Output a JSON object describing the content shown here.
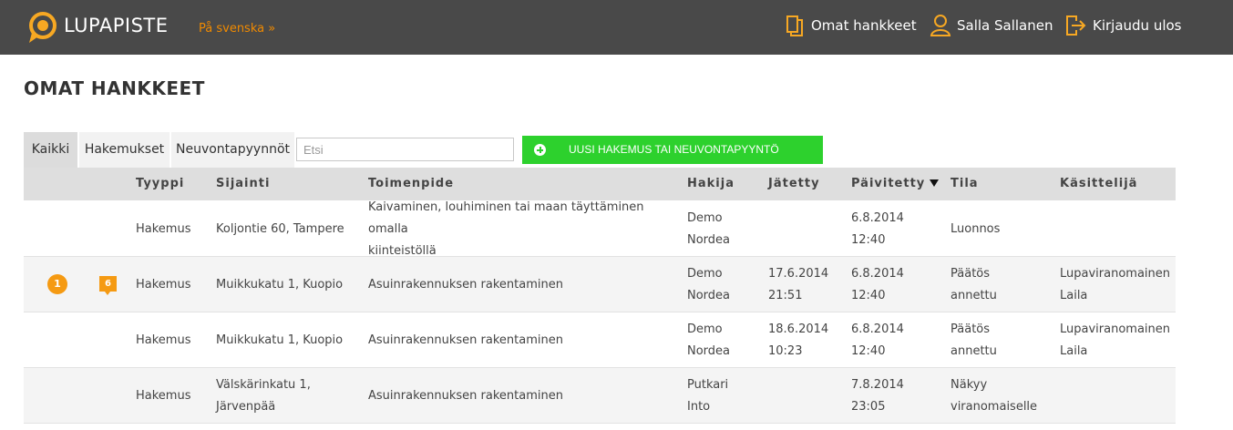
{
  "header": {
    "brand": "LUPAPISTE",
    "language_link": "På svenska »",
    "nav": {
      "projects": "Omat hankkeet",
      "user": "Salla Sallanen",
      "logout": "Kirjaudu ulos"
    },
    "accent_color": "#f08a00",
    "background_color": "#494949"
  },
  "page_title": "OMAT HANKKEET",
  "tabs": [
    {
      "label": "Kaikki",
      "active": true
    },
    {
      "label": "Hakemukset",
      "active": false
    },
    {
      "label": "Neuvontapyynnöt",
      "active": false
    }
  ],
  "search": {
    "placeholder": "Etsi",
    "value": ""
  },
  "new_button": {
    "label": "UUSI HAKEMUS TAI NEUVONTAPYYNTÖ",
    "color": "#2dd12d"
  },
  "table": {
    "columns": {
      "type": "Tyyppi",
      "location": "Sijainti",
      "operation": "Toimenpide",
      "applicant": "Hakija",
      "submitted": "Jätetty",
      "updated": "Päivitetty",
      "state": "Tila",
      "handler": "Käsittelijä"
    },
    "sorted_by": "updated",
    "sort_direction": "descending",
    "rows": [
      {
        "indicator": "",
        "comments": "",
        "type": "Hakemus",
        "location": [
          "Koljontie 60, Tampere"
        ],
        "operation": [
          "Kaivaminen, louhiminen tai maan täyttäminen omalla",
          "kiinteistöllä"
        ],
        "applicant": [
          "Demo",
          "Nordea"
        ],
        "submitted": [],
        "updated": [
          "6.8.2014",
          "12:40"
        ],
        "state": [
          "Luonnos"
        ],
        "handler": []
      },
      {
        "indicator": "1",
        "comments": "6",
        "type": "Hakemus",
        "location": [
          "Muikkukatu 1, Kuopio"
        ],
        "operation": [
          "Asuinrakennuksen rakentaminen"
        ],
        "applicant": [
          "Demo",
          "Nordea"
        ],
        "submitted": [
          "17.6.2014",
          "21:51"
        ],
        "updated": [
          "6.8.2014",
          "12:40"
        ],
        "state": [
          "Päätös",
          "annettu"
        ],
        "handler": [
          "Lupaviranomainen",
          "Laila"
        ]
      },
      {
        "indicator": "",
        "comments": "",
        "type": "Hakemus",
        "location": [
          "Muikkukatu 1, Kuopio"
        ],
        "operation": [
          "Asuinrakennuksen rakentaminen"
        ],
        "applicant": [
          "Demo",
          "Nordea"
        ],
        "submitted": [
          "18.6.2014",
          "10:23"
        ],
        "updated": [
          "6.8.2014",
          "12:40"
        ],
        "state": [
          "Päätös",
          "annettu"
        ],
        "handler": [
          "Lupaviranomainen",
          "Laila"
        ]
      },
      {
        "indicator": "",
        "comments": "",
        "type": "Hakemus",
        "location": [
          "Välskärinkatu 1,",
          "Järvenpää"
        ],
        "operation": [
          "Asuinrakennuksen rakentaminen"
        ],
        "applicant": [
          "Putkari",
          "Into"
        ],
        "submitted": [],
        "updated": [
          "7.8.2014",
          "23:05"
        ],
        "state": [
          "Näkyy",
          "viranomaiselle"
        ],
        "handler": []
      }
    ]
  }
}
